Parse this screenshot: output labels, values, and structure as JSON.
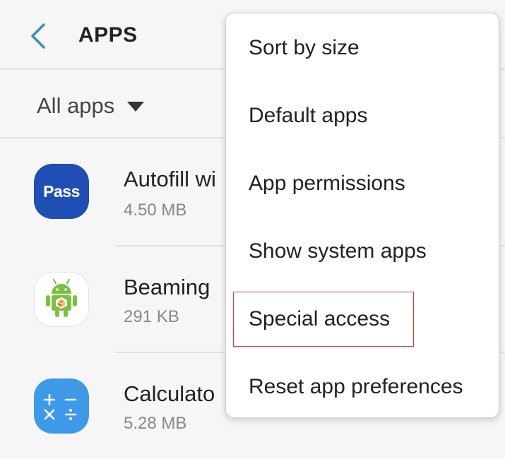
{
  "header": {
    "title": "APPS"
  },
  "filter": {
    "label": "All apps"
  },
  "apps": [
    {
      "name": "Autofill wi",
      "size": "4.50 MB",
      "icon": "pass-app-icon",
      "icon_text": "Pass",
      "icon_color": "#1f4fb5"
    },
    {
      "name": "Beaming",
      "size": "291 KB",
      "icon": "android-app-icon"
    },
    {
      "name": "Calculato",
      "size": "5.28 MB",
      "icon": "calculator-app-icon",
      "icon_color": "#3e9ae8"
    }
  ],
  "menu": {
    "items": [
      {
        "label": "Sort by size"
      },
      {
        "label": "Default apps"
      },
      {
        "label": "App permissions"
      },
      {
        "label": "Show system apps"
      },
      {
        "label": "Special access",
        "highlighted": true
      },
      {
        "label": "Reset app preferences"
      }
    ]
  },
  "colors": {
    "accent": "#3b8ec4",
    "highlight_border": "#e0353b",
    "background": "#f6f6f6"
  }
}
